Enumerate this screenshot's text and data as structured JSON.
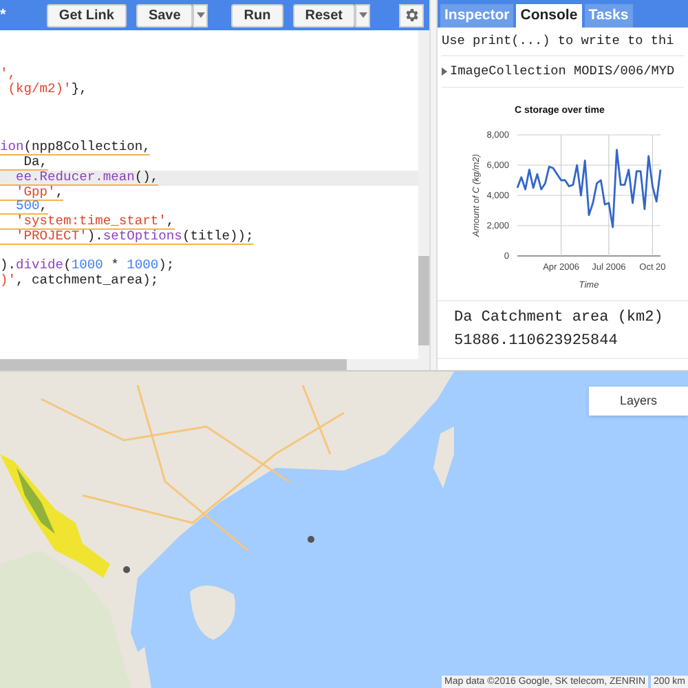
{
  "toolbar": {
    "title_fragment": "*",
    "buttons": [
      {
        "label": "Get Link",
        "dropdown": false
      },
      {
        "label": "Save",
        "dropdown": true
      },
      {
        "label": "Run",
        "dropdown": false
      },
      {
        "label": "Reset",
        "dropdown": true
      }
    ]
  },
  "editor": {
    "lines": [
      {
        "kind": "code",
        "warning": false,
        "current": false,
        "tokens": [
          {
            "kind": "string",
            "text": "',"
          }
        ]
      },
      {
        "kind": "code",
        "warning": false,
        "current": false,
        "tokens": [
          {
            "kind": "string",
            "text": " (kg/m2)'"
          },
          {
            "kind": "plain",
            "text": "},"
          }
        ]
      },
      {
        "kind": "blank"
      },
      {
        "kind": "blank"
      },
      {
        "kind": "blank"
      },
      {
        "kind": "code",
        "warning": true,
        "current": false,
        "tokens": [
          {
            "kind": "function",
            "text": "ion"
          },
          {
            "kind": "plain",
            "text": "(npp8Collection,"
          }
        ]
      },
      {
        "kind": "code",
        "warning": true,
        "current": false,
        "tokens": [
          {
            "kind": "plain",
            "text": "   Da,"
          }
        ]
      },
      {
        "kind": "code",
        "warning": true,
        "current": true,
        "tokens": [
          {
            "kind": "function",
            "text": "  ee.Reducer.mean"
          },
          {
            "kind": "plain",
            "text": "(),"
          }
        ]
      },
      {
        "kind": "code",
        "warning": true,
        "current": false,
        "tokens": [
          {
            "kind": "string",
            "text": "  'Gpp'"
          },
          {
            "kind": "plain",
            "text": ","
          }
        ]
      },
      {
        "kind": "code",
        "warning": true,
        "current": false,
        "tokens": [
          {
            "kind": "number",
            "text": "  500"
          },
          {
            "kind": "plain",
            "text": ","
          }
        ]
      },
      {
        "kind": "code",
        "warning": true,
        "current": false,
        "tokens": [
          {
            "kind": "string",
            "text": "  'system:time_start'"
          },
          {
            "kind": "plain",
            "text": ","
          }
        ]
      },
      {
        "kind": "code",
        "warning": true,
        "current": false,
        "tokens": [
          {
            "kind": "string",
            "text": "  'PROJECT'"
          },
          {
            "kind": "plain",
            "text": ")."
          },
          {
            "kind": "function",
            "text": "setOptions"
          },
          {
            "kind": "plain",
            "text": "(title));"
          }
        ]
      },
      {
        "kind": "blank"
      },
      {
        "kind": "code",
        "warning": false,
        "current": false,
        "tokens": [
          {
            "kind": "plain",
            "text": ")."
          },
          {
            "kind": "function",
            "text": "divide"
          },
          {
            "kind": "plain",
            "text": "("
          },
          {
            "kind": "number",
            "text": "1000"
          },
          {
            "kind": "plain",
            "text": " * "
          },
          {
            "kind": "number",
            "text": "1000"
          },
          {
            "kind": "plain",
            "text": ");"
          }
        ]
      },
      {
        "kind": "code",
        "warning": false,
        "current": false,
        "tokens": [
          {
            "kind": "string",
            "text": ")'"
          },
          {
            "kind": "plain",
            "text": ", catchment_area);"
          }
        ]
      }
    ]
  },
  "tabs": [
    {
      "label": "Inspector",
      "selected": false
    },
    {
      "label": "Console",
      "selected": true
    },
    {
      "label": "Tasks",
      "selected": false
    }
  ],
  "console": {
    "hint": "Use print(...) to write to thi",
    "collection": "ImageCollection MODIS/006/MYD",
    "chart_data": {
      "type": "line",
      "title": "C storage over time",
      "xlabel": "Time",
      "ylabel": "Amount of C (kg/m2)",
      "categories": [
        null,
        null,
        null,
        null,
        null,
        null,
        null,
        null,
        null,
        null,
        null,
        "Apr 2006",
        null,
        null,
        null,
        null,
        null,
        null,
        null,
        null,
        null,
        null,
        null,
        "Jul 2006",
        null,
        null,
        null,
        null,
        null,
        null,
        null,
        null,
        null,
        null,
        "Oct 20",
        null,
        null
      ],
      "series": [
        {
          "color": "#3366cc",
          "values": [
            4500,
            5200,
            4400,
            5700,
            4500,
            5400,
            4400,
            4800,
            5900,
            5800,
            5400,
            5000,
            5000,
            4600,
            4700,
            6000,
            4000,
            6300,
            2700,
            3500,
            4800,
            5000,
            3400,
            3500,
            1900,
            7000,
            4700,
            4700,
            5700,
            3500,
            5600,
            5600,
            3100,
            6600,
            4600,
            3600,
            5700
          ]
        }
      ],
      "grid": true,
      "ylim": [
        0,
        8000
      ],
      "yticks": [
        {
          "value": 0,
          "label": "0"
        },
        {
          "value": 2000,
          "label": "2,000"
        },
        {
          "value": 4000,
          "label": "4,000"
        },
        {
          "value": 6000,
          "label": "6,000"
        },
        {
          "value": 8000,
          "label": "8,000"
        }
      ]
    },
    "output_label": "Da Catchment area (km2)",
    "output_value": "51886.110623925844"
  },
  "map": {
    "layers_button": "Layers",
    "attribution": "Map data ©2016 Google, SK telecom, ZENRIN",
    "scale": "200 km"
  }
}
